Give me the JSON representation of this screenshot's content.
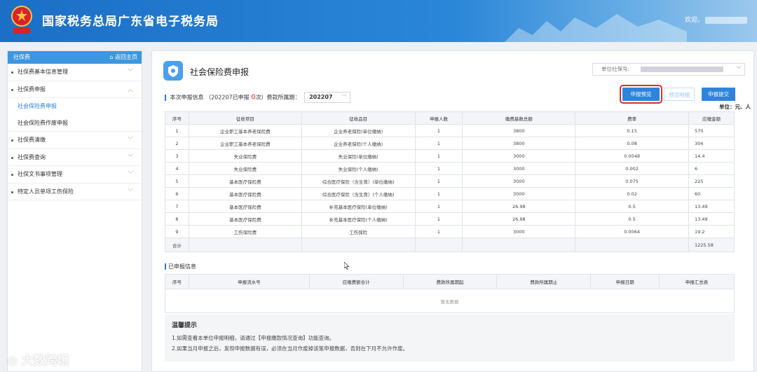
{
  "header": {
    "title": "国家税务总局广东省电子税务局",
    "welcome": "欢迎，",
    "emblem_text": "中国税务"
  },
  "sidebar": {
    "head_label": "社保费",
    "home_label": "⌂ 返回主页",
    "items": [
      {
        "label": "社保费基本信息管理",
        "chevron": "chevron-down"
      },
      {
        "label": "社保费申报",
        "chevron": "chevron-up"
      }
    ],
    "sub_items": [
      {
        "label": "社会保险费申报",
        "active": true
      },
      {
        "label": "社会保险费作废申报",
        "active": false
      }
    ],
    "items_after": [
      {
        "label": "社保费清缴"
      },
      {
        "label": "社保费查询"
      },
      {
        "label": "社保文书事项管理"
      },
      {
        "label": "特定人员单项工伤保险"
      }
    ]
  },
  "main": {
    "title": "社会保险费申报",
    "unit_label": "单位社保号:",
    "info_title": "本次申报信息",
    "info_pre": "（202207已申报 ",
    "info_count": "0",
    "info_post": "次）费款所属期：",
    "period_value": "202207",
    "buttons": {
      "preview": "申报预览",
      "detail": "预览明细",
      "submit": "申报提交"
    },
    "unit_note": "单位：元、人"
  },
  "table1": {
    "headers": [
      "序号",
      "征收项目",
      "征收品目",
      "申报人数",
      "缴费基数总额",
      "费率",
      "应缴金额"
    ],
    "rows": [
      [
        "1",
        "企业职工基本养老保险费",
        "企业养老保险(单位缴纳)",
        "1",
        "3800",
        "0.15",
        "570"
      ],
      [
        "2",
        "企业职工基本养老保险费",
        "企业养老保险(个人缴纳)",
        "1",
        "3800",
        "0.08",
        "304"
      ],
      [
        "3",
        "失业保险费",
        "失业保险(单位缴纳)",
        "1",
        "3000",
        "0.0048",
        "14.4"
      ],
      [
        "4",
        "失业保险费",
        "失业保险(个人缴纳)",
        "1",
        "3000",
        "0.002",
        "6"
      ],
      [
        "5",
        "基本医疗保险费",
        "综合医疗保险（含生育）(单位缴纳)",
        "1",
        "3000",
        "0.075",
        "225"
      ],
      [
        "6",
        "基本医疗保险费",
        "综合医疗保险（含生育）(个人缴纳)",
        "1",
        "3000",
        "0.02",
        "60"
      ],
      [
        "7",
        "基本医疗保险费",
        "补充基本医疗保险(单位缴纳)",
        "1",
        "26.98",
        "0.5",
        "13.49"
      ],
      [
        "8",
        "基本医疗保险费",
        "补充基本医疗保险(个人缴纳)",
        "1",
        "26.98",
        "0.5",
        "13.49"
      ],
      [
        "9",
        "工伤保险费",
        "工伤保险",
        "1",
        "3000",
        "0.0064",
        "19.2"
      ]
    ],
    "total_label": "合计",
    "total_value": "1225.58"
  },
  "section2": {
    "title": "已申报信息",
    "headers": [
      "序号",
      "申报流水号",
      "应缴费额合计",
      "费款所属期起",
      "费款所属期止",
      "申报日期",
      "申报汇总表"
    ],
    "empty": "暂无数据"
  },
  "tips": {
    "title": "温馨提示",
    "lines": [
      "1.如需查看本单位申报明细，请通过【申报缴款情况查询】功能查询。",
      "2.如果当月申报之后，发现申报数据有误，必须在当月作废掉该笔申报数据，否则在下月不允许作废。"
    ]
  },
  "watermark": "大数跨境",
  "colors": {
    "header_blue": "#1b6fc6",
    "accent": "#2d84dc",
    "highlight_red": "#e02b2b",
    "count_red": "#e02222"
  }
}
